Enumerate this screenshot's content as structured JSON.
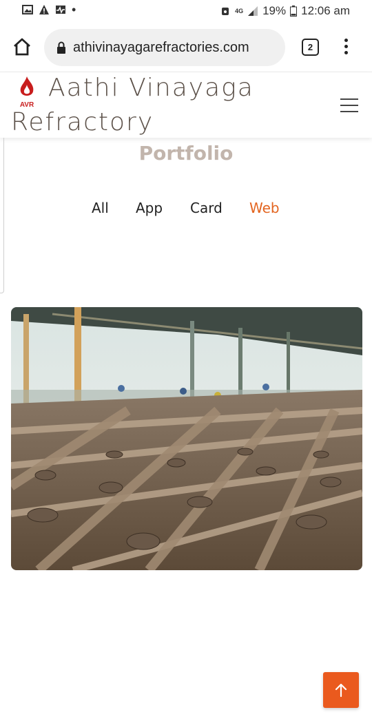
{
  "status_bar": {
    "battery": "19%",
    "time": "12:06 am",
    "network": "4G"
  },
  "browser": {
    "url": "athivinayagarefractories.com",
    "tab_count": "2"
  },
  "site": {
    "logo_text": "AVR",
    "brand_line1": "Aathi Vinayaga",
    "brand_line2": "Refractory"
  },
  "portfolio": {
    "title": "Portfolio",
    "filters": [
      {
        "label": "All",
        "active": false
      },
      {
        "label": "App",
        "active": false
      },
      {
        "label": "Card",
        "active": false
      },
      {
        "label": "Web",
        "active": true
      }
    ]
  },
  "colors": {
    "accent": "#e3641f",
    "title": "#c2b5ac",
    "brand": "#5b5048",
    "back_to_top": "#ea5a1e"
  },
  "icons": {
    "back_to_top": "arrow-up-icon",
    "home": "home-icon",
    "lock": "lock-icon",
    "menu": "hamburger-icon"
  }
}
